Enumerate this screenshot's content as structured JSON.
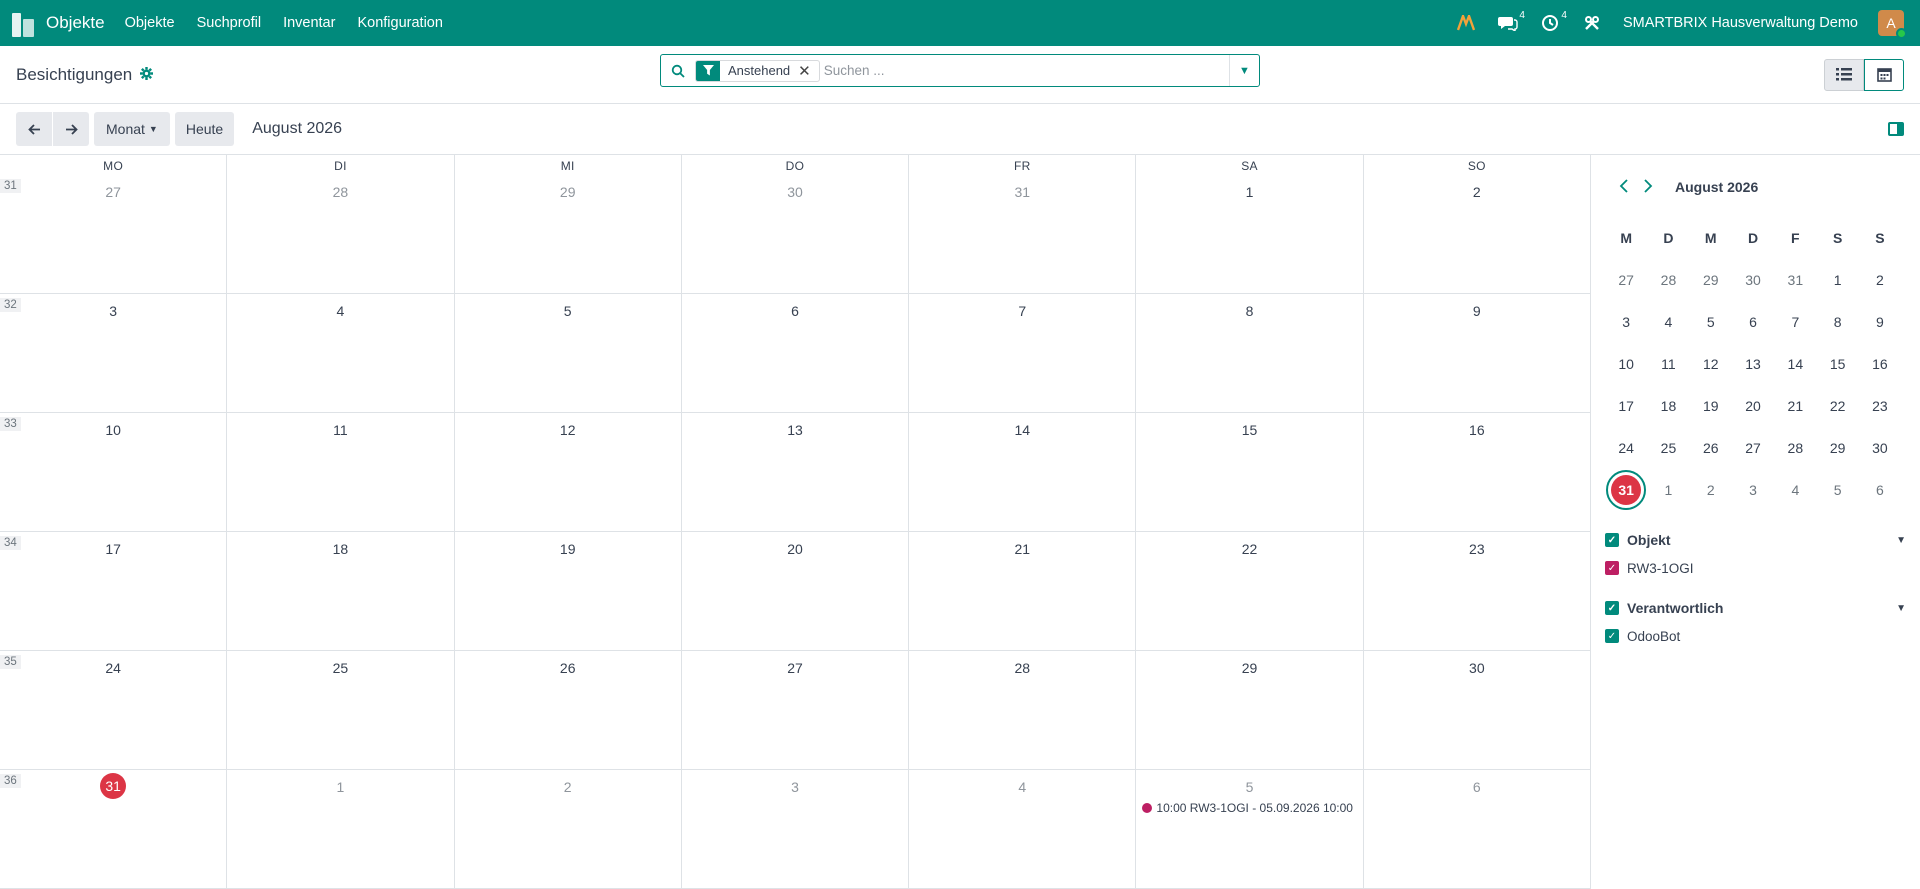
{
  "navbar": {
    "app_name": "Objekte",
    "menu": [
      "Objekte",
      "Suchprofil",
      "Inventar",
      "Konfiguration"
    ],
    "messages_count": "4",
    "activities_count": "4",
    "company": "SMARTBRIX Hausverwaltung Demo",
    "avatar_letter": "A",
    "colors": {
      "bar": "#018a7c"
    }
  },
  "control": {
    "title": "Besichtigungen",
    "facet_label": "Anstehend",
    "search_placeholder": "Suchen ..."
  },
  "toolbar": {
    "scale_label": "Monat",
    "today_label": "Heute",
    "range": "August 2026"
  },
  "calendar": {
    "weekdays": [
      "MO",
      "DI",
      "MI",
      "DO",
      "FR",
      "SA",
      "SO"
    ],
    "weeks": [
      {
        "num": "31",
        "days": [
          [
            "27",
            true
          ],
          [
            "28",
            true
          ],
          [
            "29",
            true
          ],
          [
            "30",
            true
          ],
          [
            "31",
            true
          ],
          [
            "1",
            false
          ],
          [
            "2",
            false
          ]
        ]
      },
      {
        "num": "32",
        "days": [
          [
            "3",
            false
          ],
          [
            "4",
            false
          ],
          [
            "5",
            false
          ],
          [
            "6",
            false
          ],
          [
            "7",
            false
          ],
          [
            "8",
            false
          ],
          [
            "9",
            false
          ]
        ]
      },
      {
        "num": "33",
        "days": [
          [
            "10",
            false
          ],
          [
            "11",
            false
          ],
          [
            "12",
            false
          ],
          [
            "13",
            false
          ],
          [
            "14",
            false
          ],
          [
            "15",
            false
          ],
          [
            "16",
            false
          ]
        ]
      },
      {
        "num": "34",
        "days": [
          [
            "17",
            false
          ],
          [
            "18",
            false
          ],
          [
            "19",
            false
          ],
          [
            "20",
            false
          ],
          [
            "21",
            false
          ],
          [
            "22",
            false
          ],
          [
            "23",
            false
          ]
        ]
      },
      {
        "num": "35",
        "days": [
          [
            "24",
            false
          ],
          [
            "25",
            false
          ],
          [
            "26",
            false
          ],
          [
            "27",
            false
          ],
          [
            "28",
            false
          ],
          [
            "29",
            false
          ],
          [
            "30",
            false
          ]
        ]
      },
      {
        "num": "36",
        "days": [
          [
            "31",
            false
          ],
          [
            "1",
            true
          ],
          [
            "2",
            true
          ],
          [
            "3",
            true
          ],
          [
            "4",
            true
          ],
          [
            "5",
            true
          ],
          [
            "6",
            true
          ]
        ]
      }
    ],
    "today": "31",
    "event": {
      "text": "10:00 RW3-1OGI - 05.09.2026 10:00",
      "color": "#bd1f63"
    }
  },
  "sidebar": {
    "mini_title": "August 2026",
    "mini_weekdays": [
      "M",
      "D",
      "M",
      "D",
      "F",
      "S",
      "S"
    ],
    "mini_weeks": [
      [
        [
          "27",
          true
        ],
        [
          "28",
          true
        ],
        [
          "29",
          true
        ],
        [
          "30",
          true
        ],
        [
          "31",
          true
        ],
        [
          "1",
          false
        ],
        [
          "2",
          false
        ]
      ],
      [
        [
          "3",
          false
        ],
        [
          "4",
          false
        ],
        [
          "5",
          false
        ],
        [
          "6",
          false
        ],
        [
          "7",
          false
        ],
        [
          "8",
          false
        ],
        [
          "9",
          false
        ]
      ],
      [
        [
          "10",
          false
        ],
        [
          "11",
          false
        ],
        [
          "12",
          false
        ],
        [
          "13",
          false
        ],
        [
          "14",
          false
        ],
        [
          "15",
          false
        ],
        [
          "16",
          false
        ]
      ],
      [
        [
          "17",
          false
        ],
        [
          "18",
          false
        ],
        [
          "19",
          false
        ],
        [
          "20",
          false
        ],
        [
          "21",
          false
        ],
        [
          "22",
          false
        ],
        [
          "23",
          false
        ]
      ],
      [
        [
          "24",
          false
        ],
        [
          "25",
          false
        ],
        [
          "26",
          false
        ],
        [
          "27",
          false
        ],
        [
          "28",
          false
        ],
        [
          "29",
          false
        ],
        [
          "30",
          false
        ]
      ],
      [
        [
          "31",
          false
        ],
        [
          "1",
          true
        ],
        [
          "2",
          true
        ],
        [
          "3",
          true
        ],
        [
          "4",
          true
        ],
        [
          "5",
          true
        ],
        [
          "6",
          true
        ]
      ]
    ],
    "filters": [
      {
        "title": "Objekt",
        "items": [
          {
            "label": "RW3-1OGI",
            "color": "#bd1f63"
          }
        ]
      },
      {
        "title": "Verantwortlich",
        "items": [
          {
            "label": "OdooBot",
            "color": "#018a7c"
          }
        ]
      }
    ]
  }
}
